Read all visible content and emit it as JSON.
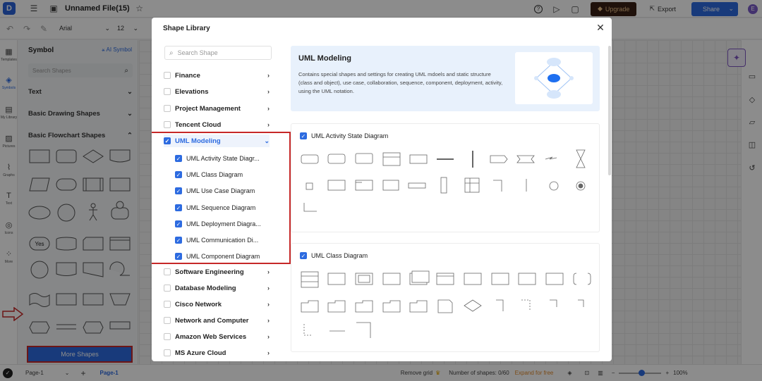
{
  "topbar": {
    "file_title": "Unnamed File(15)",
    "upgrade_label": "Upgrade",
    "export_label": "Export",
    "share_label": "Share",
    "avatar_initial": "E"
  },
  "toolbar": {
    "font_name": "Arial",
    "font_size": "12"
  },
  "leftbar": {
    "items": [
      "Templates",
      "Symbols",
      "My Library",
      "Pictures",
      "Graphs",
      "Text",
      "Icons",
      "More"
    ]
  },
  "symbol_panel": {
    "title": "Symbol",
    "ai_symbol_label": "AI Symbol",
    "search_placeholder": "Search Shapes",
    "sections": [
      "Text",
      "Basic Drawing Shapes",
      "Basic Flowchart Shapes"
    ],
    "yes_label": "Yes",
    "more_shapes_label": "More Shapes"
  },
  "bottombar": {
    "page_selector": "Page-1",
    "page_tab": "Page-1",
    "remove_grid": "Remove grid",
    "shape_count": "Number of shapes: 0/60",
    "expand": "Expand for free",
    "zoom": "100%"
  },
  "modal": {
    "title": "Shape Library",
    "search_placeholder": "Search Shape",
    "categories_top": [
      "Finance",
      "Elevations",
      "Project Management",
      "Tencent Cloud"
    ],
    "active_category": "UML Modeling",
    "subcategories": [
      "UML Activity State Diagr...",
      "UML Class Diagram",
      "UML Use Case Diagram",
      "UML Sequence Diagram",
      "UML Deployment Diagra...",
      "UML Communication Di...",
      "UML Component Diagram"
    ],
    "categories_bottom": [
      "Software Engineering",
      "Database Modeling",
      "Cisco Network",
      "Network and Computer",
      "Amazon Web Services",
      "MS Azure Cloud"
    ],
    "banner": {
      "title": "UML Modeling",
      "description": "Contains special shapes and settings for creating UML mdoels and static structure (class and object), use case, collaboration, sequence, component, deployment, activity, using the UML notation."
    },
    "groups": [
      {
        "name": "UML Activity State Diagram"
      },
      {
        "name": "UML Class Diagram"
      }
    ]
  },
  "colors": {
    "accent": "#2d6be0",
    "highlight_red": "#c62828",
    "upgrade_bg": "#3a1f14"
  }
}
